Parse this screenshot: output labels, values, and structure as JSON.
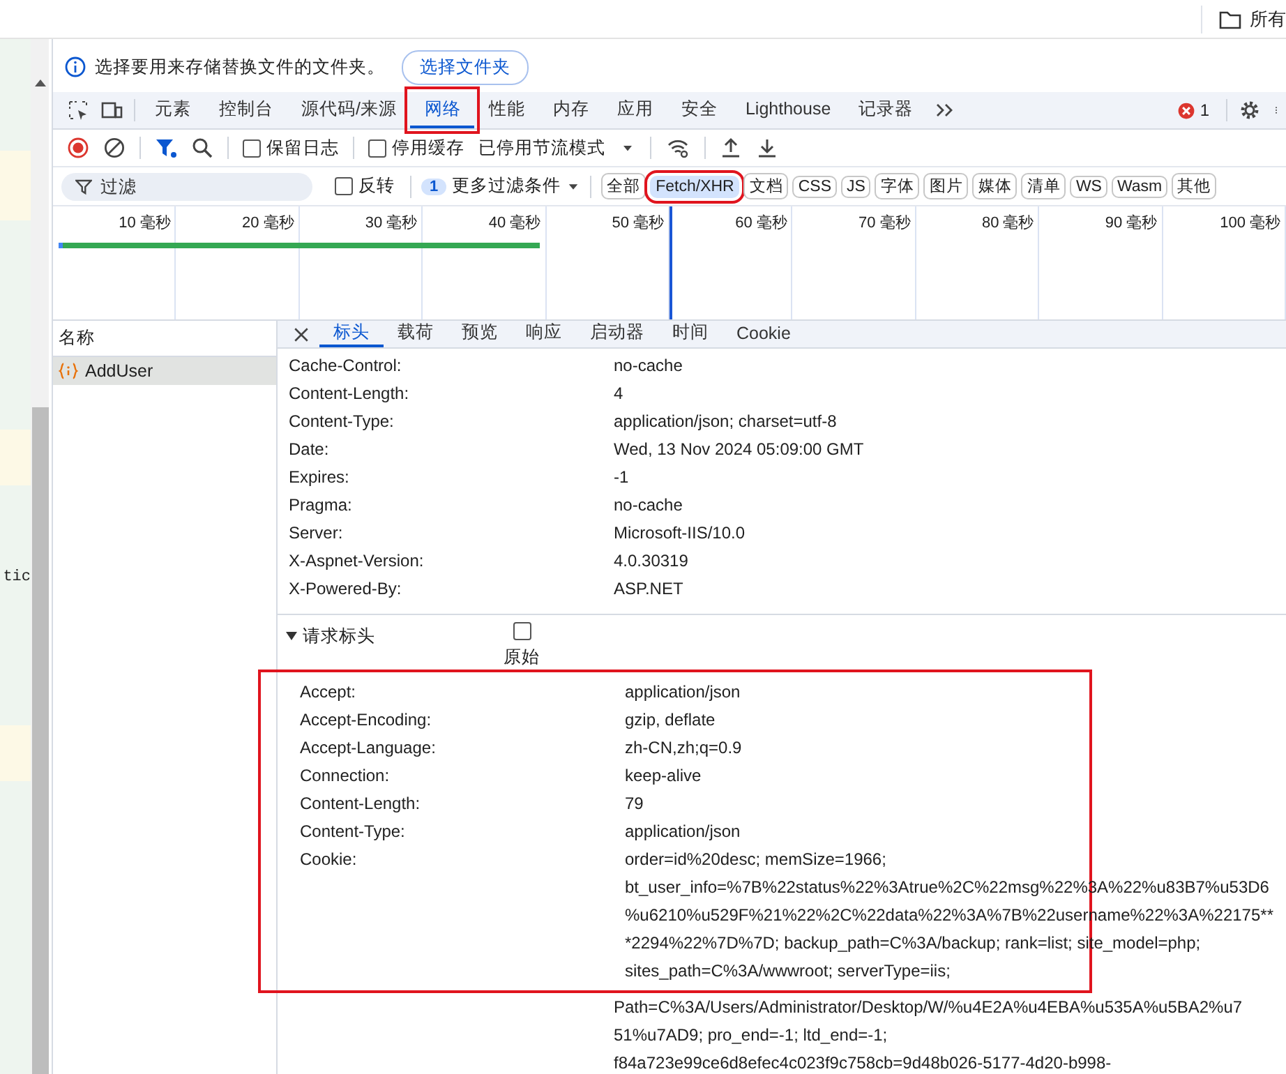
{
  "browser_bar": {
    "text": "所有"
  },
  "page_strip": {
    "text": "tic"
  },
  "infobar": {
    "message": "选择要用来存储替换文件的文件夹。",
    "button": "选择文件夹"
  },
  "tabs": [
    {
      "label": "元素",
      "selected": false,
      "highlighted": false
    },
    {
      "label": "控制台",
      "selected": false,
      "highlighted": false
    },
    {
      "label": "源代码/来源",
      "selected": false,
      "highlighted": false
    },
    {
      "label": "网络",
      "selected": true,
      "highlighted": true
    },
    {
      "label": "性能",
      "selected": false,
      "highlighted": false
    },
    {
      "label": "内存",
      "selected": false,
      "highlighted": false
    },
    {
      "label": "应用",
      "selected": false,
      "highlighted": false
    },
    {
      "label": "安全",
      "selected": false,
      "highlighted": false
    },
    {
      "label": "Lighthouse",
      "selected": false,
      "highlighted": false
    },
    {
      "label": "记录器",
      "selected": false,
      "highlighted": false
    }
  ],
  "error_count": "1",
  "toolbar": {
    "preserve_log": {
      "label": "保留日志",
      "checked": false
    },
    "disable_cache": {
      "label": "停用缓存",
      "checked": false
    },
    "throttling": "已停用节流模式"
  },
  "filter": {
    "placeholder": "过滤",
    "invert": {
      "label": "反转",
      "checked": false
    },
    "more_filters_count": "1",
    "more_filters": "更多过滤条件",
    "types": [
      {
        "label": "全部",
        "selected": false,
        "highlighted": false
      },
      {
        "label": "Fetch/XHR",
        "selected": true,
        "highlighted": true
      },
      {
        "label": "文档",
        "selected": false,
        "highlighted": false
      },
      {
        "label": "CSS",
        "selected": false,
        "highlighted": false
      },
      {
        "label": "JS",
        "selected": false,
        "highlighted": false
      },
      {
        "label": "字体",
        "selected": false,
        "highlighted": false
      },
      {
        "label": "图片",
        "selected": false,
        "highlighted": false
      },
      {
        "label": "媒体",
        "selected": false,
        "highlighted": false
      },
      {
        "label": "清单",
        "selected": false,
        "highlighted": false
      },
      {
        "label": "WS",
        "selected": false,
        "highlighted": false
      },
      {
        "label": "Wasm",
        "selected": false,
        "highlighted": false
      },
      {
        "label": "其他",
        "selected": false,
        "highlighted": false
      }
    ]
  },
  "timeline": {
    "ticks": [
      "10 毫秒",
      "20 毫秒",
      "30 毫秒",
      "40 毫秒",
      "50 毫秒",
      "60 毫秒",
      "70 毫秒",
      "80 毫秒",
      "90 毫秒",
      "100 毫秒"
    ]
  },
  "requests": {
    "column": "名称",
    "rows": [
      {
        "name": "AddUser",
        "selected": true
      }
    ]
  },
  "detail_tabs": [
    {
      "label": "标头",
      "selected": true
    },
    {
      "label": "载荷",
      "selected": false
    },
    {
      "label": "预览",
      "selected": false
    },
    {
      "label": "响应",
      "selected": false
    },
    {
      "label": "启动器",
      "selected": false
    },
    {
      "label": "时间",
      "selected": false
    },
    {
      "label": "Cookie",
      "selected": false
    }
  ],
  "response_headers": [
    {
      "name": "Cache-Control:",
      "value": "no-cache"
    },
    {
      "name": "Content-Length:",
      "value": "4"
    },
    {
      "name": "Content-Type:",
      "value": "application/json; charset=utf-8"
    },
    {
      "name": "Date:",
      "value": "Wed, 13 Nov 2024 05:09:00 GMT"
    },
    {
      "name": "Expires:",
      "value": "-1"
    },
    {
      "name": "Pragma:",
      "value": "no-cache"
    },
    {
      "name": "Server:",
      "value": "Microsoft-IIS/10.0"
    },
    {
      "name": "X-Aspnet-Version:",
      "value": "4.0.30319"
    },
    {
      "name": "X-Powered-By:",
      "value": "ASP.NET"
    }
  ],
  "request_headers": {
    "title": "请求标头",
    "expanded": true,
    "highlighted": true,
    "raw": {
      "label": "原始",
      "checked": false
    },
    "headers": [
      {
        "name": "Accept:",
        "value": "application/json"
      },
      {
        "name": "Accept-Encoding:",
        "value": "gzip, deflate"
      },
      {
        "name": "Accept-Language:",
        "value": "zh-CN,zh;q=0.9"
      },
      {
        "name": "Connection:",
        "value": "keep-alive"
      },
      {
        "name": "Content-Length:",
        "value": "79"
      },
      {
        "name": "Content-Type:",
        "value": "application/json"
      },
      {
        "name": "Cookie:",
        "lines": [
          "order=id%20desc; memSize=1966;",
          "bt_user_info=%7B%22status%22%3Atrue%2C%22msg%22%3A%22%u83B7%u53D6",
          "%u6210%u529F%21%22%2C%22data%22%3A%7B%22username%22%3A%22175**",
          "*2294%22%7D%7D; backup_path=C%3A/backup; rank=list; site_model=php;",
          "sites_path=C%3A/wwwroot; serverType=iis;",
          "Path=C%3A/Users/Administrator/Desktop/W/%u4E2A%u4EBA%u535A%u5BA2%u7",
          "51%u7AD9; pro_end=-1; ltd_end=-1;",
          "f84a723e99ce6d8efec4c023f9c758cb=9d48b026-5177-4d20-b998-"
        ]
      }
    ]
  }
}
